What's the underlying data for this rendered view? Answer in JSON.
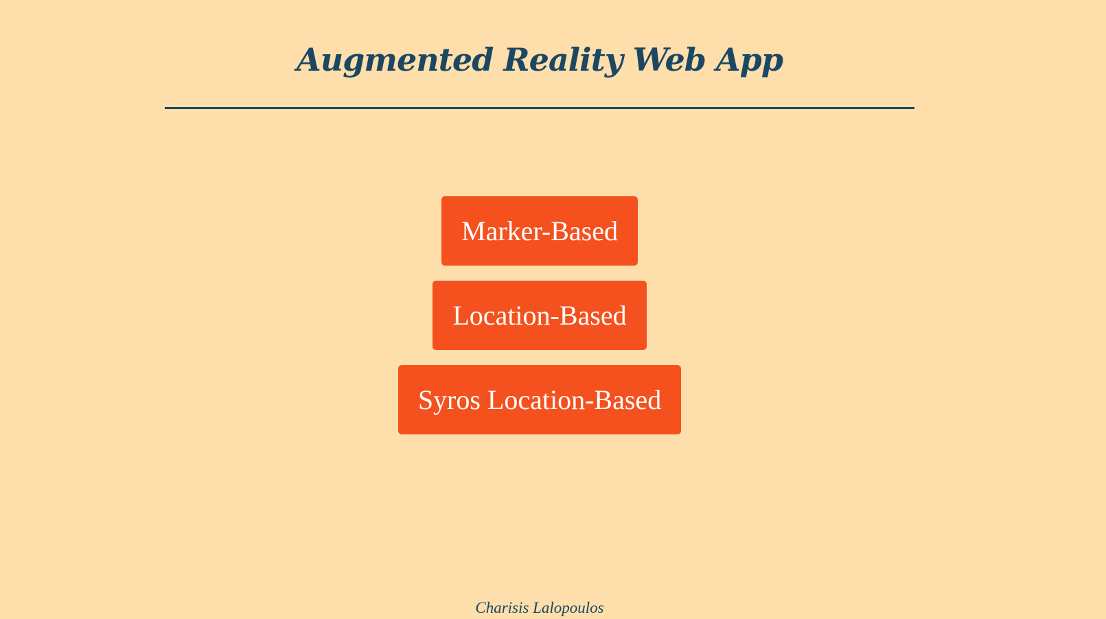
{
  "header": {
    "title": "Augmented Reality Web App"
  },
  "buttons": [
    {
      "label": "Marker-Based"
    },
    {
      "label": "Location-Based"
    },
    {
      "label": "Syros Location-Based"
    }
  ],
  "footer": {
    "author": "Charisis Lalopoulos"
  },
  "colors": {
    "background": "#FEDEAB",
    "accent": "#F4511E",
    "text_dark": "#1C4763",
    "button_text": "#FFFFFF"
  }
}
